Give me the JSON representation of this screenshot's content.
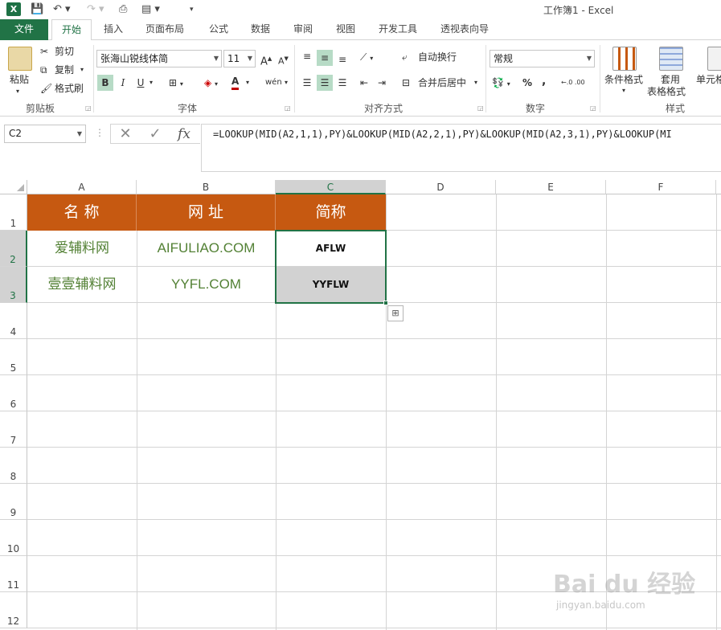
{
  "window": {
    "title": "工作簿1 - Excel"
  },
  "tabs": [
    "文件",
    "开始",
    "插入",
    "页面布局",
    "公式",
    "数据",
    "审阅",
    "视图",
    "开发工具",
    "透视表向导"
  ],
  "clipboard": {
    "paste": "粘贴",
    "cut": "剪切",
    "copy": "复制",
    "format_painter": "格式刷",
    "group": "剪贴板"
  },
  "font": {
    "name": "张海山锐线体简",
    "size": "11",
    "bold": "B",
    "italic": "I",
    "underline": "U",
    "font_color": "A",
    "phonetic": "wén",
    "group": "字体"
  },
  "alignment": {
    "wrap": "自动换行",
    "merge": "合并后居中",
    "group": "对齐方式"
  },
  "number": {
    "format": "常规",
    "percent": "%",
    "comma": ",",
    "inc": "←.0 .00",
    "dec": ".00 →.0",
    "group": "数字"
  },
  "styles": {
    "conditional": "条件格式",
    "table_line1": "套用",
    "table_line2": "表格格式",
    "cell": "单元格",
    "group": "样式"
  },
  "formula_bar": {
    "name_box": "C2",
    "fx": "fx",
    "formula": "=LOOKUP(MID(A2,1,1),PY)&LOOKUP(MID(A2,2,1),PY)&LOOKUP(MID(A2,3,1),PY)&LOOKUP(MI"
  },
  "sheet": {
    "columns": [
      "A",
      "B",
      "C",
      "D",
      "E",
      "F"
    ],
    "rows": [
      "1",
      "2",
      "3",
      "4",
      "5",
      "6",
      "7",
      "8",
      "9",
      "10",
      "11",
      "12"
    ],
    "header_row": [
      "名 称",
      "网 址",
      "简称"
    ],
    "data_rows": [
      [
        "爱辅料网",
        "AIFULIAO.COM",
        "AFLW"
      ],
      [
        "壹壹辅料网",
        "YYFL.COM",
        "YYFLW"
      ]
    ],
    "colors": {
      "header_fill": "#c65911",
      "header_text": "#ffffff",
      "green_text": "#538135",
      "selection": "#217346"
    }
  },
  "watermark": {
    "main": "Bai du 经验",
    "sub": "jingyan.baidu.com"
  }
}
